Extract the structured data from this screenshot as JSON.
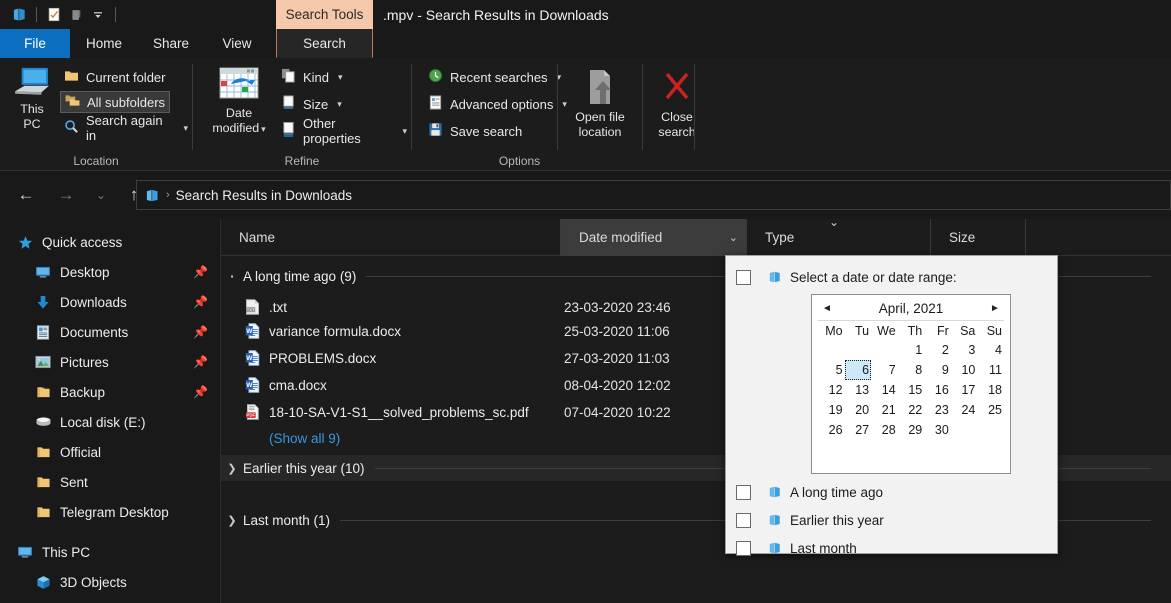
{
  "titlebar": {
    "tools_label": "Search Tools",
    "window_title": ".mpv - Search Results in Downloads",
    "qat_icons": [
      "explorer-icon",
      "properties-icon",
      "new-folder-icon",
      "customize-chevron-icon"
    ]
  },
  "tabs": [
    {
      "label": "File",
      "name": "tab-file"
    },
    {
      "label": "Home",
      "name": "tab-home"
    },
    {
      "label": "Share",
      "name": "tab-share"
    },
    {
      "label": "View",
      "name": "tab-view"
    },
    {
      "label": "Search",
      "name": "tab-search"
    }
  ],
  "ribbon": {
    "groups": [
      {
        "label": "Location"
      },
      {
        "label": "Refine"
      },
      {
        "label": "Options"
      }
    ],
    "this_pc": "This\nPC",
    "this_pc_line1": "This",
    "this_pc_line2": "PC",
    "current_folder": "Current folder",
    "all_subfolders": "All subfolders",
    "search_again_in": "Search again in",
    "date_modified_line1": "Date",
    "date_modified_line2": "modified",
    "kind": "Kind",
    "size": "Size",
    "other_properties": "Other properties",
    "recent_searches": "Recent searches",
    "advanced_options": "Advanced options",
    "save_search": "Save search",
    "open_file_location_line1": "Open file",
    "open_file_location_line2": "location",
    "close_search_line1": "Close",
    "close_search_line2": "search"
  },
  "addressbar": {
    "path": "Search Results in Downloads",
    "separator": "›"
  },
  "sidebar": {
    "items": [
      {
        "label": "Quick access",
        "icon": "star-icon",
        "level": 0,
        "pinned": false
      },
      {
        "label": "Desktop",
        "icon": "desktop-icon",
        "level": 1,
        "pinned": true
      },
      {
        "label": "Downloads",
        "icon": "downloads-icon",
        "level": 1,
        "pinned": true
      },
      {
        "label": "Documents",
        "icon": "documents-icon",
        "level": 1,
        "pinned": true
      },
      {
        "label": "Pictures",
        "icon": "pictures-icon",
        "level": 1,
        "pinned": true
      },
      {
        "label": "Backup",
        "icon": "folder-icon",
        "level": 1,
        "pinned": true
      },
      {
        "label": "Local disk (E:)",
        "icon": "drive-icon",
        "level": 1,
        "pinned": false
      },
      {
        "label": "Official",
        "icon": "folder-icon",
        "level": 1,
        "pinned": false
      },
      {
        "label": "Sent",
        "icon": "folder-icon",
        "level": 1,
        "pinned": false
      },
      {
        "label": "Telegram Desktop",
        "icon": "folder-icon",
        "level": 1,
        "pinned": false
      },
      {
        "label": "This PC",
        "icon": "this-pc-icon",
        "level": 0,
        "pinned": false
      },
      {
        "label": "3D Objects",
        "icon": "3d-objects-icon",
        "level": 1,
        "pinned": false
      }
    ]
  },
  "filelist": {
    "columns": [
      {
        "label": "Name",
        "name": "column-name"
      },
      {
        "label": "Date modified",
        "name": "column-date-modified"
      },
      {
        "label": "Type",
        "name": "column-type"
      },
      {
        "label": "Size",
        "name": "column-size"
      }
    ],
    "groups": [
      {
        "label": "A long time ago (9)",
        "expanded": true
      },
      {
        "label": "Earlier this year (10)",
        "expanded": false
      },
      {
        "label": "Last month (1)",
        "expanded": false
      }
    ],
    "show_all_label": "(Show all 9)",
    "rows": [
      {
        "name": ".txt",
        "date": "23-03-2020 23:46",
        "icon": "txt-file-icon"
      },
      {
        "name": "variance formula.docx",
        "date": "25-03-2020 11:06",
        "icon": "word-file-icon"
      },
      {
        "name": "PROBLEMS.docx",
        "date": "27-03-2020 11:03",
        "icon": "word-file-icon"
      },
      {
        "name": "cma.docx",
        "date": "08-04-2020 12:02",
        "icon": "word-file-icon"
      },
      {
        "name": "18-10-SA-V1-S1__solved_problems_sc.pdf",
        "date": "07-04-2020 10:22",
        "icon": "pdf-file-icon"
      }
    ]
  },
  "date_dropdown": {
    "select_range_label": "Select a date or date range:",
    "month_label": "April, 2021",
    "prev_arrow": "◄",
    "next_arrow": "►",
    "weekdays": [
      "Mo",
      "Tu",
      "We",
      "Th",
      "Fr",
      "Sa",
      "Su"
    ],
    "weeks": [
      [
        "",
        "",
        "",
        "1",
        "2",
        "3",
        "4"
      ],
      [
        "5",
        "6",
        "7",
        "8",
        "9",
        "10",
        "11"
      ],
      [
        "12",
        "13",
        "14",
        "15",
        "16",
        "17",
        "18"
      ],
      [
        "19",
        "20",
        "21",
        "22",
        "23",
        "24",
        "25"
      ],
      [
        "26",
        "27",
        "28",
        "29",
        "30",
        "",
        ""
      ]
    ],
    "selected_day": "6",
    "options": [
      {
        "label": "A long time ago",
        "checked": false
      },
      {
        "label": "Earlier this year",
        "checked": false
      },
      {
        "label": "Last month",
        "checked": false
      }
    ]
  },
  "colors": {
    "accent_blue": "#0b6ebe",
    "search_tools_tab": "#f5c8ac",
    "link_blue": "#3a96dd",
    "close_red": "#cc2222",
    "panel_bg": "#f2f2f2",
    "selection_blue": "#cde8f7",
    "window_bg": "#191919"
  }
}
